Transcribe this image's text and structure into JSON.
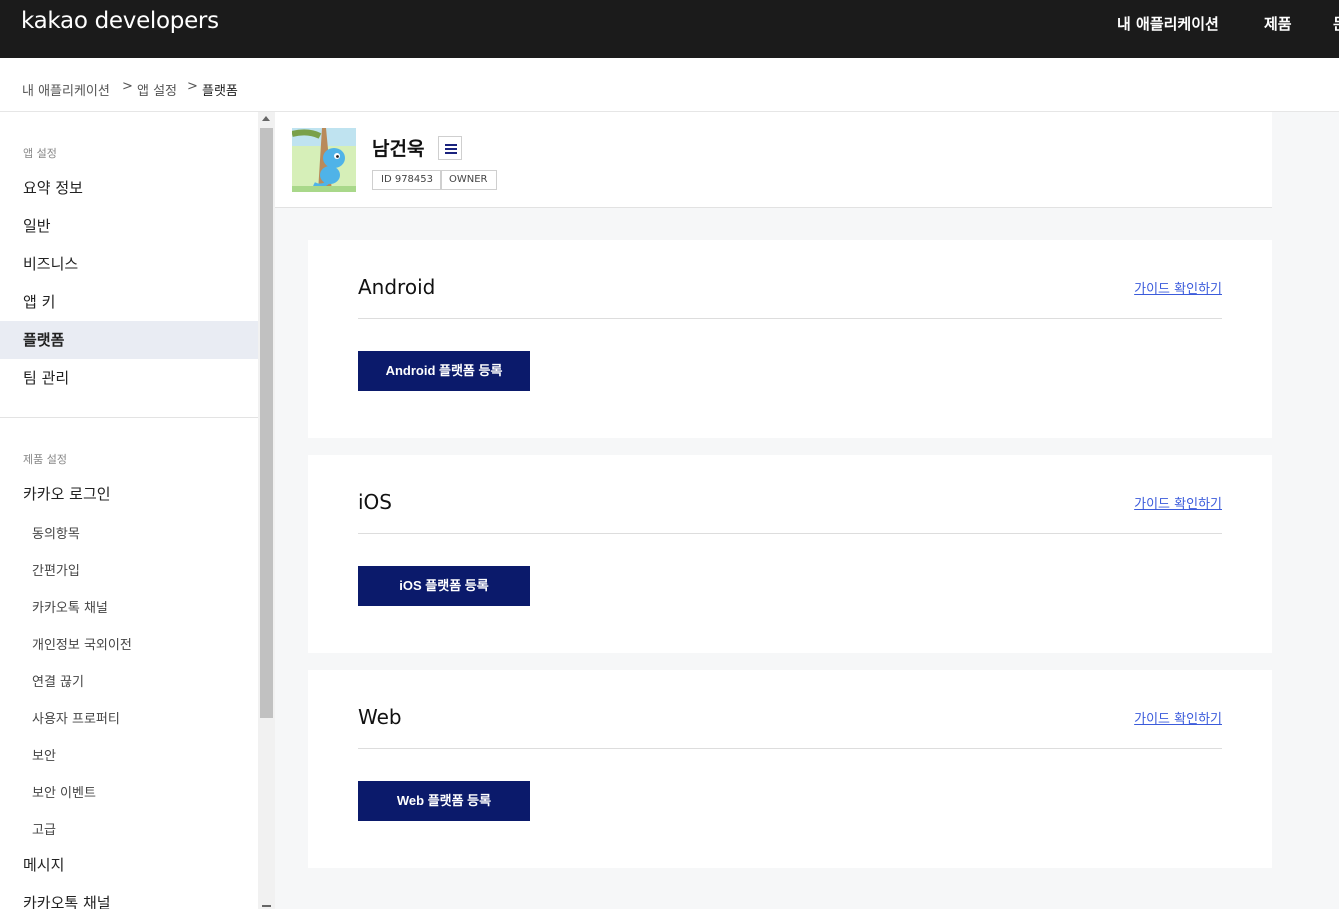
{
  "header": {
    "logo_brand": "kakao",
    "logo_suffix": " developers",
    "nav": [
      "내 애플리케이션",
      "제품",
      "문"
    ]
  },
  "breadcrumb": {
    "items": [
      "내 애플리케이션",
      "앱 설정",
      "플랫폼"
    ],
    "separator": ">"
  },
  "sidebar": {
    "section1_title": "앱 설정",
    "section1_items": [
      "요약 정보",
      "일반",
      "비즈니스",
      "앱 키",
      "플랫폼",
      "팀 관리"
    ],
    "active_item": "플랫폼",
    "section2_title": "제품 설정",
    "kakao_login": "카카오 로그인",
    "kakao_login_sub": [
      "동의항목",
      "간편가입",
      "카카오톡 채널",
      "개인정보 국외이전",
      "연결 끊기",
      "사용자 프로퍼티",
      "보안",
      "보안 이벤트",
      "고급"
    ],
    "message": "메시지",
    "kakaotalk_channel": "카카오톡 채널"
  },
  "app": {
    "name": "남건욱",
    "id_tag": "ID 978453",
    "role_tag": "OWNER"
  },
  "platforms": [
    {
      "title": "Android",
      "guide": "가이드 확인하기",
      "button": "Android 플랫폼 등록"
    },
    {
      "title": "iOS",
      "guide": "가이드 확인하기",
      "button": "iOS 플랫폼 등록"
    },
    {
      "title": "Web",
      "guide": "가이드 확인하기",
      "button": "Web 플랫폼 등록"
    }
  ],
  "colors": {
    "header_bg": "#1b1b1b",
    "button_bg": "#0b1a6b",
    "link": "#3b5bdb",
    "active_bg": "#e9ecf3"
  }
}
